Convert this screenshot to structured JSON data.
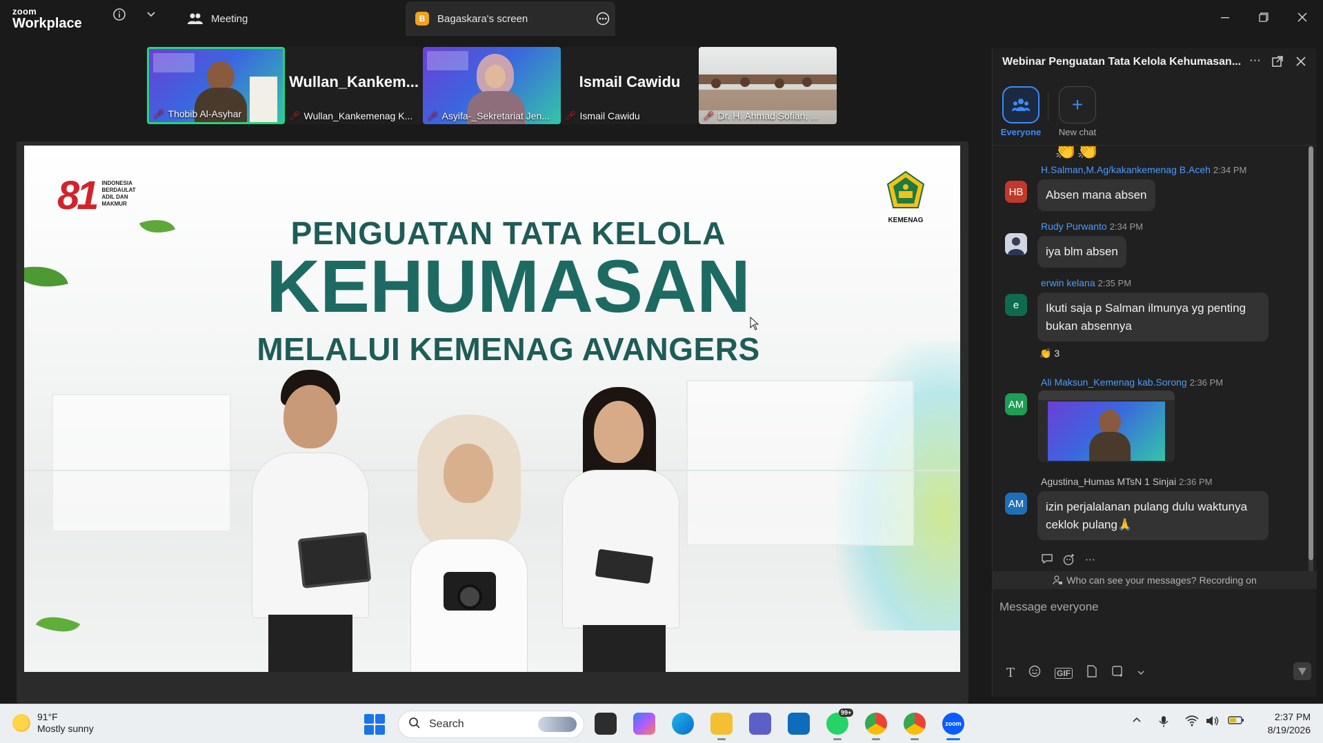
{
  "titlebar": {
    "logo_line1": "zoom",
    "logo_line2": "Workplace",
    "meeting_tab": "Meeting",
    "screen_tab": "Bagaskara's screen",
    "screen_tab_badge": "B"
  },
  "participants": [
    {
      "name": "Thobib Al-Asyhar",
      "muted": true,
      "active_speaker": true,
      "video": "webinar-slide"
    },
    {
      "name": "Wullan_Kankemenag K...",
      "big_name": "Wullan_Kankem...",
      "muted": true,
      "video": "none"
    },
    {
      "name": "Asyifa-_Sekretariat Jen...",
      "muted": true,
      "video": "webinar-slide"
    },
    {
      "name": "Ismail Cawidu",
      "big_name": "Ismail Cawidu",
      "muted": true,
      "video": "none"
    },
    {
      "name": "Dr. H. Ahmad Sofian, ...",
      "muted": true,
      "video": "classroom"
    }
  ],
  "slide": {
    "badge_number": "81",
    "badge_text": [
      "INDONESIA",
      "BERDAULAT",
      "ADIL DAN",
      "MAKMUR"
    ],
    "org_label": "KEMENAG",
    "title_line1": "PENGUATAN TATA KELOLA",
    "title_line2": "KEHUMASAN",
    "title_line3": "MELALUI KEMENAG AVANGERS"
  },
  "chat": {
    "title": "Webinar Penguatan Tata Kelola Kehumasan...",
    "tab_everyone": "Everyone",
    "tab_new_chat": "New chat",
    "messages": [
      {
        "initials": "HB",
        "avatar_color": "#c0392b",
        "sender": "H.Salman,M.Ag/kakankemenag B.Aceh",
        "time": "2:34 PM",
        "text": "Absen mana absen"
      },
      {
        "initials": "",
        "avatar_color": "#5a6b8c",
        "sender": "Rudy Purwanto",
        "time": "2:34 PM",
        "text": "iya  blm absen"
      },
      {
        "initials": "e",
        "avatar_color": "#0f6b4f",
        "sender": "erwin kelana",
        "time": "2:35 PM",
        "text": "Ikuti saja p Salman ilmunya yg penting bukan absennya",
        "reaction": "👏",
        "reaction_count": "3"
      },
      {
        "initials": "AM",
        "avatar_color": "#1f9d55",
        "sender": "Ali Maksun_Kemenag kab.Sorong",
        "time": "2:36 PM",
        "text": ""
      },
      {
        "initials": "AM",
        "avatar_color": "#1e6fb8",
        "sender": "Agustina_Humas MTsN 1 Sinjai",
        "time": "2:36 PM",
        "text": "izin perjalalanan pulang dulu waktunya ceklok pulang🙏"
      }
    ],
    "privacy_notice": "Who can see your messages? Recording on",
    "compose_placeholder": "Message everyone",
    "gif_label": "GIF"
  },
  "taskbar": {
    "temperature": "91°F",
    "weather": "Mostly sunny",
    "search_label": "Search",
    "whatsapp_badge": "99+",
    "time": "2:37 PM",
    "date": "8/19/2026"
  },
  "colors": {
    "accent_blue": "#3a8bff",
    "active_speaker_green": "#27d37a",
    "slide_title_green": "#1d6a63",
    "mute_red": "#e0242f"
  }
}
